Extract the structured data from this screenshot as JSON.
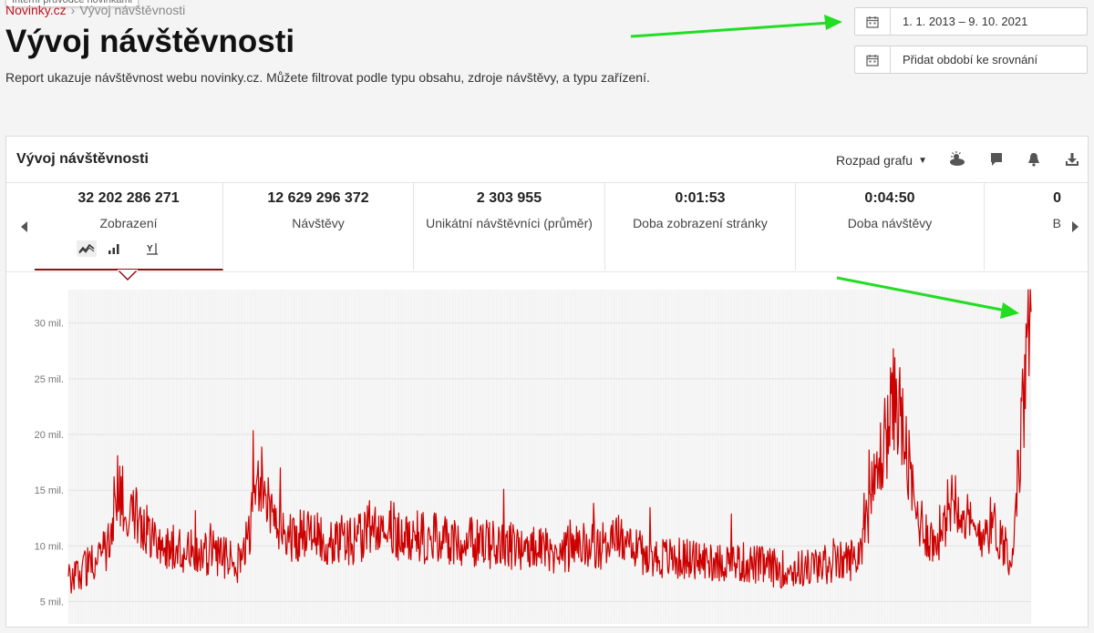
{
  "tooltip_fragment": "Interní průvodce novinkami",
  "breadcrumb": {
    "site": "Novinky.cz",
    "separator": "›",
    "current": "Vývoj návštěvnosti"
  },
  "page": {
    "title": "Vývoj návštěvnosti",
    "description": "Report ukazuje návštěvnost webu novinky.cz. Můžete filtrovat podle typu obsahu, zdroje návštěvy, a typu zařízení."
  },
  "date_range": {
    "value": "1. 1. 2013 – 9. 10. 2021",
    "icon": "calendar-icon"
  },
  "compare": {
    "label": "Přidat období ke srovnání",
    "icon": "calendar-icon"
  },
  "card": {
    "title": "Vývoj návštěvnosti",
    "breakdown_label": "Rozpad grafu",
    "tools": [
      "weather-icon",
      "comment-icon",
      "bell-icon",
      "download-icon"
    ]
  },
  "metrics": [
    {
      "value": "32 202 286 271",
      "label": "Zobrazení",
      "active": true
    },
    {
      "value": "12 629 296 372",
      "label": "Návštěvy"
    },
    {
      "value": "2 303 955",
      "label": "Unikátní návštěvníci (průměr)"
    },
    {
      "value": "0:01:53",
      "label": "Doba zobrazení stránky"
    },
    {
      "value": "0:04:50",
      "label": "Doba návštěvy"
    },
    {
      "value": "0",
      "label": "B"
    }
  ],
  "colors": {
    "brand": "#c0141e",
    "series": "#cc0000",
    "annotation": "#22dd22"
  },
  "chart_data": {
    "type": "line",
    "x": [
      0,
      0.04,
      0.05,
      0.1,
      0.18,
      0.2,
      0.22,
      0.3,
      0.33,
      0.34,
      0.4,
      0.5,
      0.55,
      0.58,
      0.6,
      0.7,
      0.75,
      0.8,
      0.82,
      0.86,
      0.88,
      0.9,
      0.92,
      0.94,
      0.96,
      0.98,
      1.0
    ],
    "series": [
      {
        "values": [
          7,
          9.5,
          15,
          10,
          8.5,
          16,
          11,
          10.5,
          13,
          11,
          10.5,
          9.5,
          10,
          11,
          9,
          8.5,
          7.8,
          8.5,
          9,
          24,
          13,
          10,
          15,
          11,
          12,
          9,
          31
        ]
      }
    ],
    "yticks": [
      "5 mil.",
      "10 mil.",
      "15 mil.",
      "20 mil.",
      "25 mil.",
      "30 mil."
    ],
    "ylim": [
      3,
      33
    ],
    "grid": true
  }
}
